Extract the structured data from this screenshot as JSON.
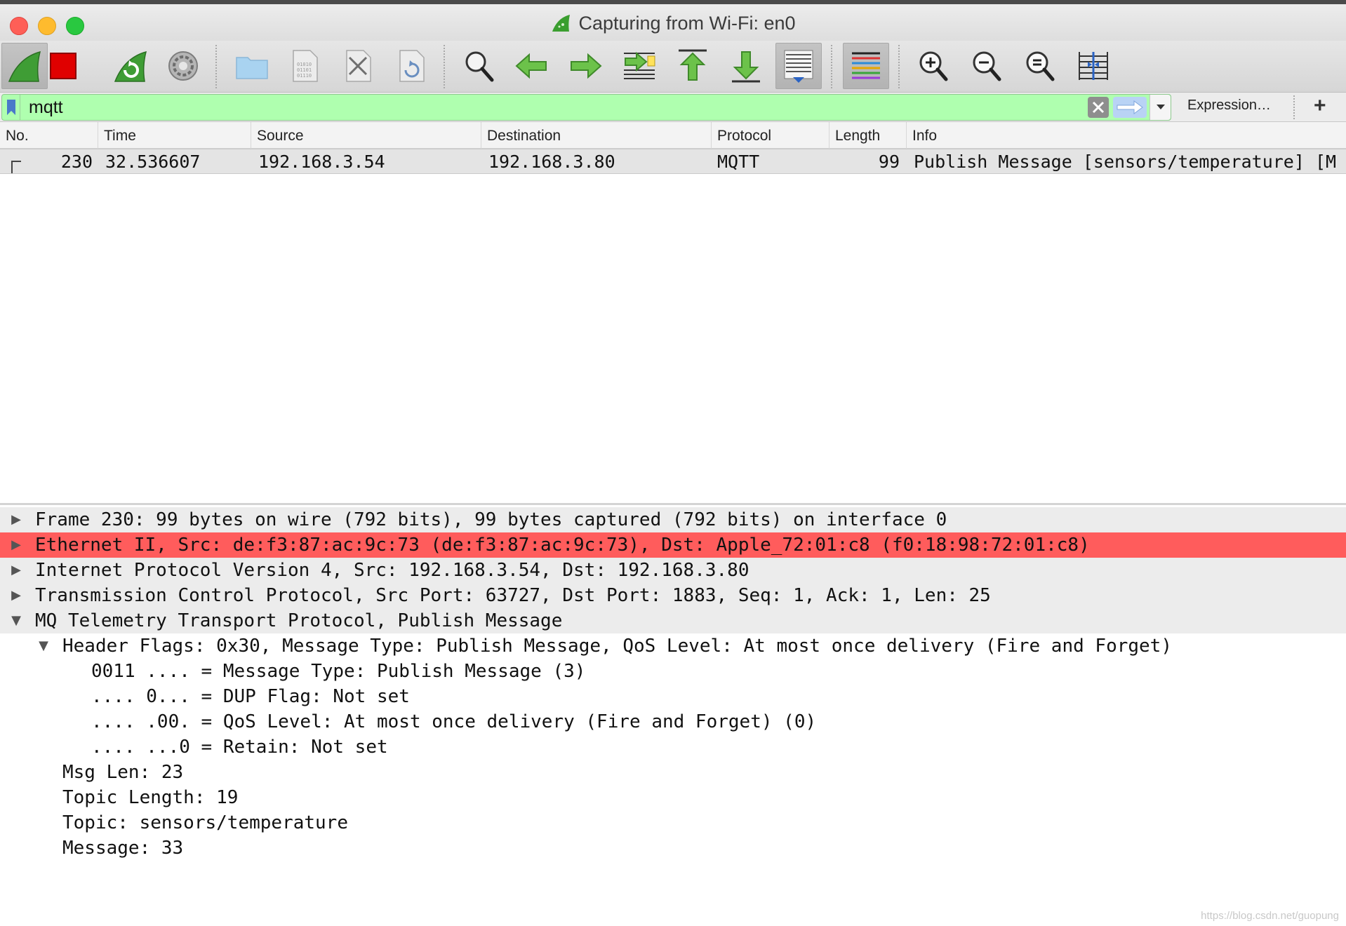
{
  "window": {
    "title": "Capturing from Wi-Fi: en0"
  },
  "toolbar": {
    "buttons": [
      {
        "name": "start-capture",
        "icon": "shark-fin-icon"
      },
      {
        "name": "stop-capture",
        "icon": "stop-square-icon"
      },
      {
        "name": "restart-capture",
        "icon": "restart-fin-icon"
      },
      {
        "name": "capture-options",
        "icon": "gear-icon"
      },
      {
        "name": "open-file",
        "icon": "folder-icon"
      },
      {
        "name": "save-file",
        "icon": "binary-file-icon"
      },
      {
        "name": "close-file",
        "icon": "close-file-icon"
      },
      {
        "name": "reload-file",
        "icon": "reload-file-icon"
      },
      {
        "name": "find-packet",
        "icon": "magnifier-icon"
      },
      {
        "name": "go-back",
        "icon": "arrow-left-icon"
      },
      {
        "name": "go-forward",
        "icon": "arrow-right-icon"
      },
      {
        "name": "go-to-packet",
        "icon": "go-to-packet-icon"
      },
      {
        "name": "go-first",
        "icon": "arrow-up-icon"
      },
      {
        "name": "go-last",
        "icon": "arrow-down-icon"
      },
      {
        "name": "auto-scroll",
        "icon": "autoscroll-icon"
      },
      {
        "name": "colorize",
        "icon": "colorize-lines-icon"
      },
      {
        "name": "zoom-in",
        "icon": "zoom-in-icon"
      },
      {
        "name": "zoom-out",
        "icon": "zoom-out-icon"
      },
      {
        "name": "zoom-normal",
        "icon": "zoom-reset-icon"
      },
      {
        "name": "resize-columns",
        "icon": "resize-columns-icon"
      }
    ]
  },
  "filter": {
    "value": "mqtt",
    "expression_label": "Expression…",
    "add_label": "+"
  },
  "packet_list": {
    "columns": [
      "No.",
      "Time",
      "Source",
      "Destination",
      "Protocol",
      "Length",
      "Info"
    ],
    "rows": [
      {
        "no": "230",
        "time": "32.536607",
        "source": "192.168.3.54",
        "destination": "192.168.3.80",
        "protocol": "MQTT",
        "length": "99",
        "info": "Publish Message [sensors/temperature] [M"
      }
    ]
  },
  "details": {
    "lines": [
      {
        "text": "Frame 230: 99 bytes on wire (792 bits), 99 bytes captured (792 bits) on interface 0",
        "arrow": "▶",
        "level": 0
      },
      {
        "text": "Ethernet II, Src: de:f3:87:ac:9c:73 (de:f3:87:ac:9c:73), Dst: Apple_72:01:c8 (f0:18:98:72:01:c8)",
        "arrow": "▶",
        "level": 0
      },
      {
        "text": "Internet Protocol Version 4, Src: 192.168.3.54, Dst: 192.168.3.80",
        "arrow": "▶",
        "level": 0
      },
      {
        "text": "Transmission Control Protocol, Src Port: 63727, Dst Port: 1883, Seq: 1, Ack: 1, Len: 25",
        "arrow": "▶",
        "level": 0
      },
      {
        "text": "MQ Telemetry Transport Protocol, Publish Message",
        "arrow": "▼",
        "level": 0
      },
      {
        "text": "Header Flags: 0x30, Message Type: Publish Message, QoS Level: At most once delivery (Fire and Forget)",
        "arrow": "▼",
        "level": 1
      },
      {
        "text": "0011 .... = Message Type: Publish Message (3)",
        "arrow": "",
        "level": 2
      },
      {
        "text": ".... 0... = DUP Flag: Not set",
        "arrow": "",
        "level": 2
      },
      {
        "text": ".... .00. = QoS Level: At most once delivery (Fire and Forget) (0)",
        "arrow": "",
        "level": 2
      },
      {
        "text": ".... ...0 = Retain: Not set",
        "arrow": "",
        "level": 2
      },
      {
        "text": "Msg Len: 23",
        "arrow": "",
        "level": 1
      },
      {
        "text": "Topic Length: 19",
        "arrow": "",
        "level": 1
      },
      {
        "text": "Topic: sensors/temperature",
        "arrow": "",
        "level": 1
      },
      {
        "text": "Message: 33",
        "arrow": "",
        "level": 1
      }
    ]
  },
  "watermark": "https://blog.csdn.net/guopung",
  "colors": {
    "filter_valid": "#afffaf",
    "highlight_row": "#ff5c5c",
    "selected_row": "#e4e4e4"
  }
}
